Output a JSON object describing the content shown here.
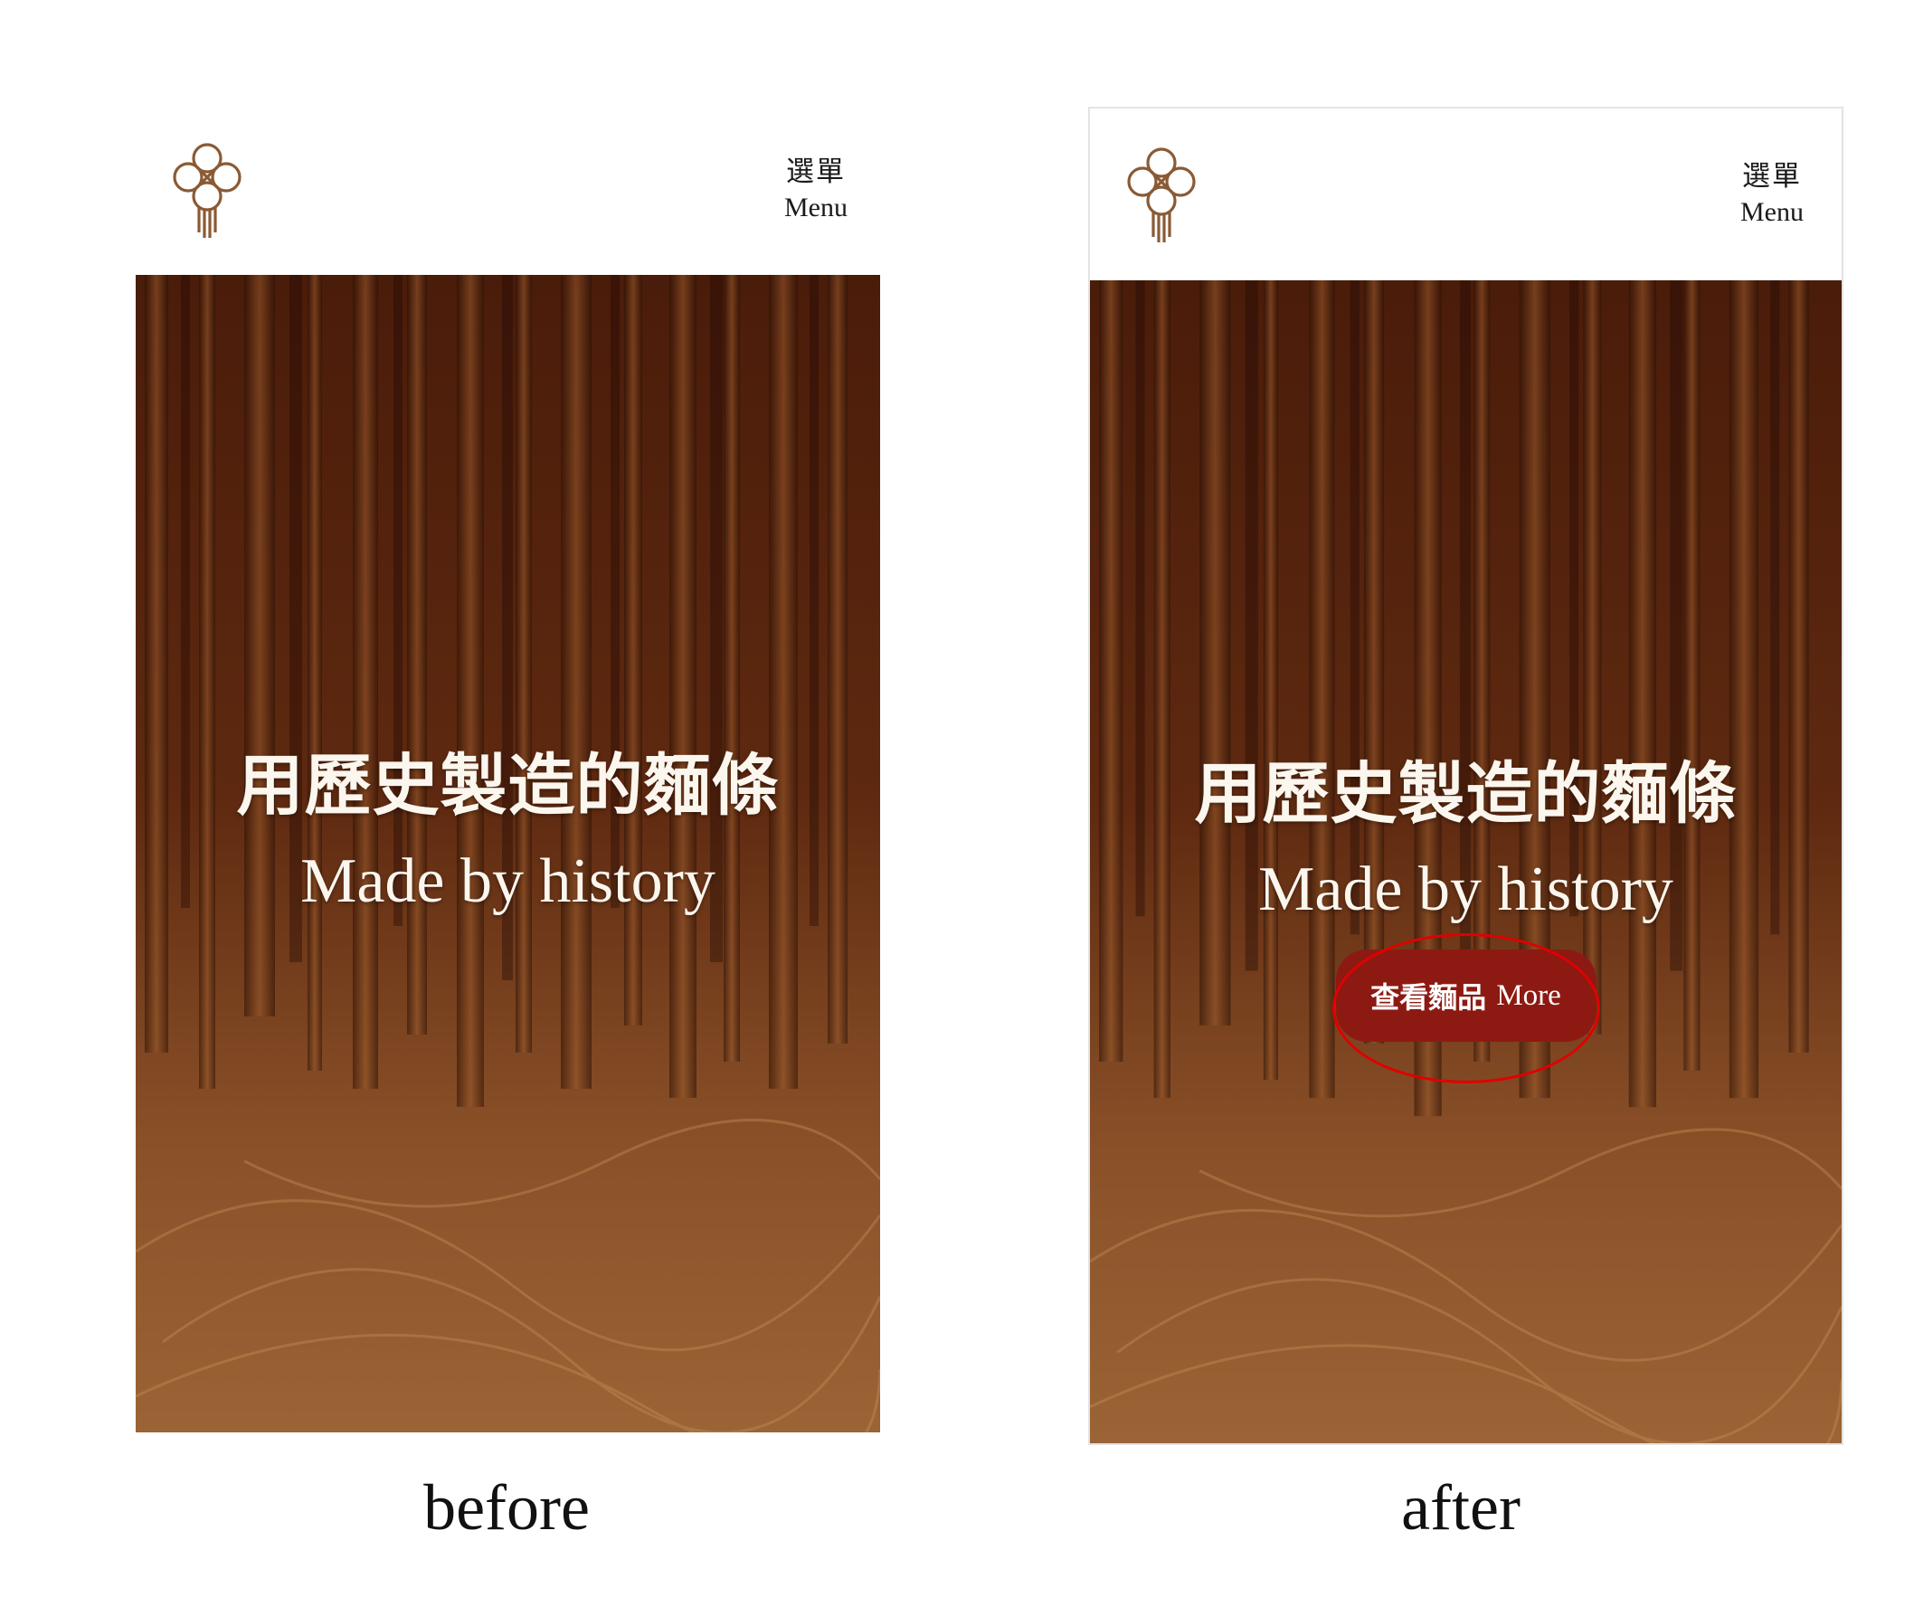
{
  "before": {
    "header": {
      "menu_zh": "選單",
      "menu_en": "Menu",
      "logo_icon": "knot-logo-icon"
    },
    "hero": {
      "title_zh": "用歷史製造的麵條",
      "title_en": "Made by history"
    },
    "caption": "before"
  },
  "after": {
    "header": {
      "menu_zh": "選單",
      "menu_en": "Menu",
      "logo_icon": "knot-logo-icon"
    },
    "hero": {
      "title_zh": "用歷史製造的麵條",
      "title_en": "Made by history"
    },
    "cta": {
      "label_zh": "查看麵品",
      "label_en": "More",
      "highlight_color": "#e00000"
    },
    "caption": "after"
  },
  "colors": {
    "logo": "#8a5a34",
    "button": "#8d1a12",
    "hero_text": "#fbf6ee",
    "hero_dark": "#2a1005",
    "hero_light": "#b07a45"
  }
}
